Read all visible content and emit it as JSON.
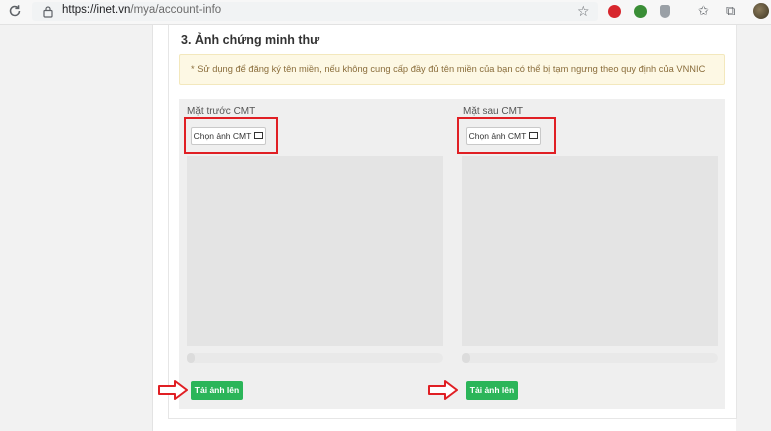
{
  "browser": {
    "url_host": "https://inet.vn",
    "url_path": "/mya/account-info",
    "extensions": [
      {
        "name": "adblock-extension-icon",
        "color": "#d7262d"
      },
      {
        "name": "green-extension-icon",
        "color": "#3a8e36"
      },
      {
        "name": "shield-extension-icon",
        "color": "#9aa0a6"
      }
    ]
  },
  "section": {
    "title": "3. Ảnh chứng minh thư",
    "notice": "* Sử dụng để đăng ký tên miền, nếu không cung cấp đầy đủ tên miền của bạn có thể bị tạm ngưng theo quy định của VNNIC"
  },
  "front": {
    "label": "Mặt trước CMT",
    "choose_label": "Chọn ảnh CMT",
    "upload_label": "Tải ảnh lên",
    "progress": 0
  },
  "back": {
    "label": "Mặt sau CMT",
    "choose_label": "Chọn ảnh CMT",
    "upload_label": "Tải ảnh lên",
    "progress": 0
  },
  "colors": {
    "highlight_red": "#e01f24",
    "upload_green": "#2bb559",
    "notice_bg": "#fdf8e4"
  }
}
